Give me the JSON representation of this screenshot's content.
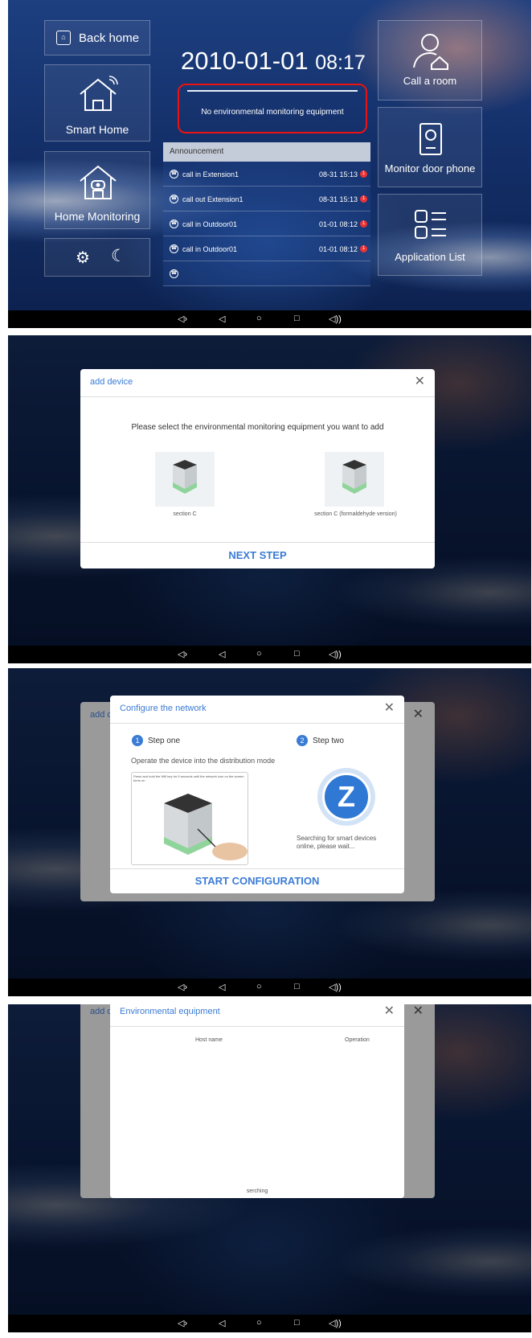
{
  "home": {
    "back_home": "Back home",
    "smart_home": "Smart Home",
    "home_monitoring": "Home Monitoring",
    "date": "2010-01-01",
    "time": "08:17",
    "alert_text": "No environmental monitoring equipment",
    "call_room": "Call a room",
    "monitor_door": "Monitor door phone",
    "app_list": "Application List",
    "announcement": "Announcement",
    "rows": [
      {
        "name": "call in Extension1",
        "time": "08-31 15:13",
        "badge": "1"
      },
      {
        "name": "call out Extension1",
        "time": "08-31 15:13",
        "badge": "1"
      },
      {
        "name": "call in Outdoor01",
        "time": "01-01 08:12",
        "badge": "1"
      },
      {
        "name": "call in Outdoor01",
        "time": "01-01 08:12",
        "badge": "1"
      }
    ]
  },
  "nav": {
    "vol_down": "◁›",
    "back": "◁",
    "home": "○",
    "recent": "□",
    "vol_up": "◁))"
  },
  "add_device": {
    "title": "add device",
    "close": "✕",
    "prompt": "Please select the environmental monitoring equipment you want to add",
    "device1": "section C",
    "device2": "section C (formaldehyde version)",
    "next": "NEXT STEP"
  },
  "configure": {
    "title": "Configure the network",
    "back_title": "add d",
    "close": "✕",
    "step1_num": "1",
    "step1": "Step one",
    "step2_num": "2",
    "step2": "Step two",
    "operate": "Operate the device into the distribution mode",
    "hint": "Press and hold the Wifi key for 5 seconds until the network icon on the screen turns on",
    "searching": "Searching for smart devices online, please wait...",
    "logo_letter": "Z",
    "start": "START CONFIGURATION"
  },
  "env": {
    "title": "Environmental equipment",
    "back_title": "add d",
    "close": "✕",
    "host": "Host name",
    "operation": "Operation",
    "status": "serching"
  },
  "colors": {
    "accent": "#3a7bd5",
    "alert": "#ee1111",
    "badge": "#ee3333"
  }
}
